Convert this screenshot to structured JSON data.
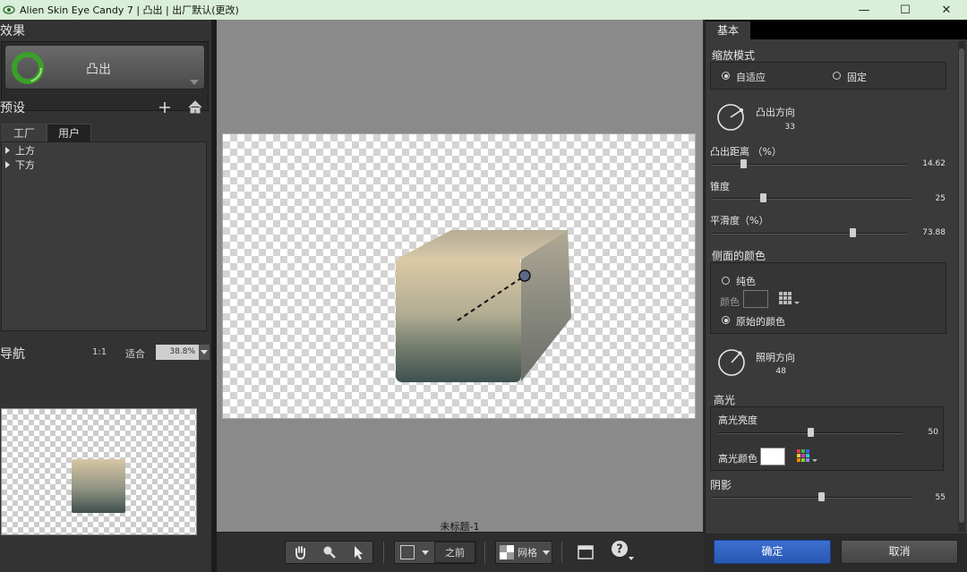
{
  "window": {
    "title": "Alien Skin Eye Candy 7 | 凸出 | 出厂默认(更改)",
    "minimize": "—",
    "maximize": "☐",
    "close": "✕"
  },
  "effects": {
    "heading": "效果",
    "current": "凸出"
  },
  "presets": {
    "heading": "预设",
    "tabs": [
      "工厂",
      "用户"
    ],
    "tree": [
      "上方",
      "下方"
    ]
  },
  "navigation": {
    "heading": "导航",
    "actual_size": "1:1",
    "fit": "适合",
    "zoom": "38.8%"
  },
  "canvas": {
    "document_name": "未标题-1",
    "bevel_direction_deg": 33
  },
  "toolbar": {
    "before_label": "之前",
    "grid_label": "网格"
  },
  "settings": {
    "tab": "基本",
    "scale_mode": {
      "label": "缩放模式",
      "options": [
        "自适应",
        "固定"
      ],
      "selected": "自适应"
    },
    "bevel_direction": {
      "label": "凸出方向",
      "value": "33"
    },
    "bevel_distance": {
      "label": "凸出距离 （%）",
      "value": "14.62",
      "fraction": 0.15
    },
    "taper": {
      "label": "锥度",
      "value": "25",
      "fraction": 0.25
    },
    "smoothness": {
      "label": "平滑度（%）",
      "value": "73.88",
      "fraction": 0.73
    },
    "side_color": {
      "label": "侧面的颜色",
      "solid": "纯色",
      "color_label": "颜色",
      "original": "原始的颜色",
      "selected": "原始的颜色"
    },
    "light_direction": {
      "label": "照明方向",
      "value": "48"
    },
    "highlight": {
      "label": "高光",
      "brightness_label": "高光亮度",
      "brightness_value": "50",
      "brightness_fraction": 0.5,
      "color_label": "高光颜色",
      "color": "#ffffff"
    },
    "shadow": {
      "label": "阴影",
      "value": "55",
      "fraction": 0.55
    }
  },
  "buttons": {
    "ok": "确定",
    "cancel": "取消"
  },
  "colors": {
    "accent": "#2f62c4",
    "titlebar": "#d9efd9"
  }
}
